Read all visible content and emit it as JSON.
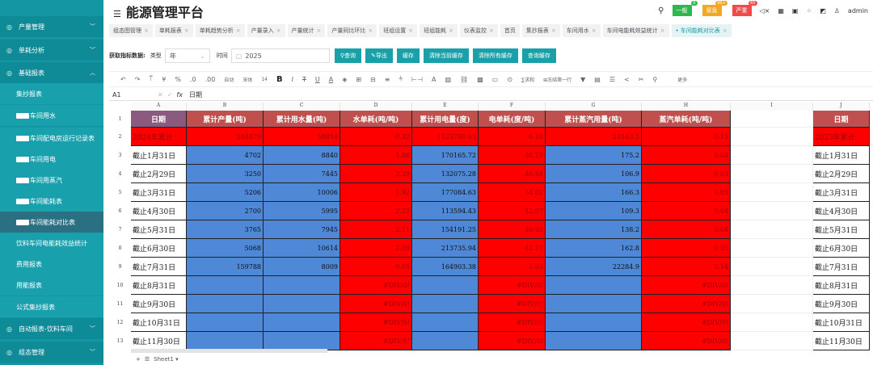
{
  "sidebar": {
    "items": [
      {
        "label": "产量管理",
        "type": "grp",
        "icon": "production-icon"
      },
      {
        "label": "单耗分析",
        "type": "grp",
        "icon": "analysis-icon"
      },
      {
        "label": "基础报表",
        "type": "grp",
        "icon": "report-icon",
        "open": true
      },
      {
        "label": "集抄报表",
        "type": "sub"
      },
      {
        "label": "车间用水",
        "type": "sub",
        "redacted": true
      },
      {
        "label": "车间配电房运行记录表",
        "type": "sub",
        "redacted": true
      },
      {
        "label": "车间用电",
        "type": "sub",
        "redacted": true
      },
      {
        "label": "车间用蒸汽",
        "type": "sub",
        "redacted": true
      },
      {
        "label": "车间能耗表",
        "type": "sub",
        "redacted": true
      },
      {
        "label": "车间能耗对比表",
        "type": "sub",
        "redacted": true,
        "active": true
      },
      {
        "label": "饮料车间电能耗效益统计",
        "type": "sub"
      },
      {
        "label": "费用报表",
        "type": "sub"
      },
      {
        "label": "用能报表",
        "type": "sub"
      },
      {
        "label": "公式集抄报表",
        "type": "sub"
      },
      {
        "label": "自动报表-饮料车间",
        "type": "grp",
        "icon": "auto-report-icon"
      },
      {
        "label": "组态管理",
        "type": "grp",
        "icon": "config-icon"
      }
    ]
  },
  "header": {
    "title": "能源管理平台",
    "alerts": [
      {
        "label": "一般",
        "count": "0",
        "color": "#2db84d"
      },
      {
        "label": "紧急",
        "count": "99+",
        "color": "#f5a623"
      },
      {
        "label": "严重",
        "count": "65",
        "color": "#f24a4a"
      }
    ],
    "user": "admin"
  },
  "tabs": [
    "组态图管理",
    "单耗报表",
    "单耗趋势分析",
    "产量录入",
    "产量统计",
    "产量同比环比",
    "班组设置",
    "班组能耗",
    "仪表监控",
    "首页",
    "集抄报表",
    "车间用水",
    "车间电能耗效益统计",
    "车间能耗对比表"
  ],
  "query": {
    "label": "获取指标数据:",
    "type_label": "类型",
    "type_value": "年",
    "time_label": "时间",
    "time_value": "2025",
    "buttons": [
      "查询",
      "导出",
      "缓存",
      "清除当前缓存",
      "清除所有缓存",
      "查询缓存"
    ]
  },
  "toolbar": {
    "font_mode": "自动",
    "font": "宋体",
    "size": "14",
    "sum": "求和",
    "freeze": "冻结第一行",
    "more": "更多"
  },
  "formula": {
    "cell": "A1",
    "value": "日期"
  },
  "sheet": {
    "columns": [
      "A",
      "B",
      "C",
      "D",
      "E",
      "F",
      "G",
      "H",
      "I",
      "J"
    ],
    "headers": [
      "日期",
      "累计产量(吨)",
      "累计用水量(吨)",
      "水单耗(吨/吨)",
      "累计用电量(度)",
      "电单耗(度/吨)",
      "累计蒸汽用量(吨)",
      "蒸汽单耗(吨/吨)",
      "",
      "日期"
    ],
    "rows": [
      [
        "2024年累计",
        "184479",
        "58854",
        "0.32",
        "1125750.63",
        "6.10",
        "23143.5",
        "0.13",
        "",
        "2023年累计"
      ],
      [
        "截止1月31日",
        "4702",
        "8840",
        "1.88",
        "170165.72",
        "36.19",
        "175.2",
        "0.04",
        "",
        "截止1月31日"
      ],
      [
        "截止2月29日",
        "3250",
        "7445",
        "2.29",
        "132075.28",
        "40.64",
        "106.9",
        "0.03",
        "",
        "截止2月29日"
      ],
      [
        "截止3月31日",
        "5206",
        "10006",
        "1.92",
        "177084.63",
        "34.02",
        "166.3",
        "0.03",
        "",
        "截止3月31日"
      ],
      [
        "截止4月30日",
        "2700",
        "5995",
        "2.22",
        "113594.43",
        "42.07",
        "109.3",
        "0.04",
        "",
        "截止4月30日"
      ],
      [
        "截止5月31日",
        "3765",
        "7945",
        "2.11",
        "154191.25",
        "40.95",
        "138.2",
        "0.04",
        "",
        "截止5月31日"
      ],
      [
        "截止6月30日",
        "5068",
        "10614",
        "2.09",
        "213735.94",
        "42.17",
        "162.8",
        "0.03",
        "",
        "截止6月30日"
      ],
      [
        "截止7月31日",
        "159788",
        "8009",
        "0.05",
        "164903.38",
        "1.03",
        "22284.9",
        "0.14",
        "",
        "截止7月31日"
      ],
      [
        "截止8月31日",
        "",
        "",
        "#DIV/0!",
        "",
        "#DIV/0!",
        "",
        "#DIV/0!",
        "",
        "截止8月31日"
      ],
      [
        "截止9月30日",
        "",
        "",
        "#DIV/0!",
        "",
        "#DIV/0!",
        "",
        "#DIV/0!",
        "",
        "截止9月30日"
      ],
      [
        "截止10月31日",
        "",
        "",
        "#DIV/0!",
        "",
        "#DIV/0!",
        "",
        "#DIV/0!",
        "",
        "截止10月31日"
      ],
      [
        "截止11月30日",
        "",
        "",
        "#DIV/0!",
        "",
        "#DIV/0!",
        "",
        "#DIV/0!",
        "",
        "截止11月30日"
      ]
    ],
    "sheet_name": "Sheet1"
  },
  "colors": {
    "header": "#c0504d",
    "red": "#ff0000",
    "blue": "#4f88d6",
    "a1": "#8c5a7e",
    "teal": "#1596a3"
  }
}
